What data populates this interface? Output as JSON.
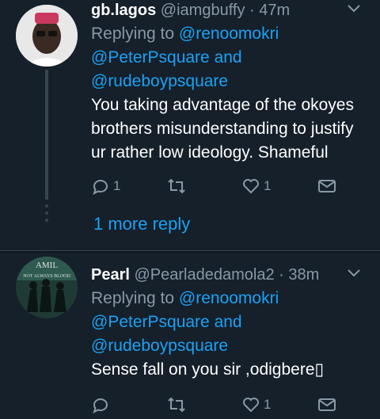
{
  "tweets": [
    {
      "name": "gb.lagos",
      "handle": "@iamgbuffy",
      "time": "47m",
      "replying_prefix": "Replying to",
      "mentions": [
        "@renoomokri",
        "@PeterPsquare",
        "@rudeboypsquare"
      ],
      "and_word": "and",
      "text": "You taking advantage of the okoyes brothers misunderstanding to justify ur rather low ideology. Shameful",
      "reply_count": "1",
      "like_count": "1",
      "more_replies": "1 more reply"
    },
    {
      "name": "Pearl",
      "handle": "@Pearladedamola2",
      "time": "38m",
      "replying_prefix": "Replying to",
      "mentions": [
        "@renoomokri",
        "@PeterPsquare",
        "@rudeboypsquare"
      ],
      "and_word": "and",
      "text": "Sense fall on you sir ,odigbere▯",
      "like_count": "1",
      "avatar_text": "AMIL NOT ALWAYS BLOOD"
    }
  ],
  "separator": "·",
  "colors": {
    "background": "#15202b",
    "accent": "#1da1f2",
    "muted": "#8899a6"
  }
}
